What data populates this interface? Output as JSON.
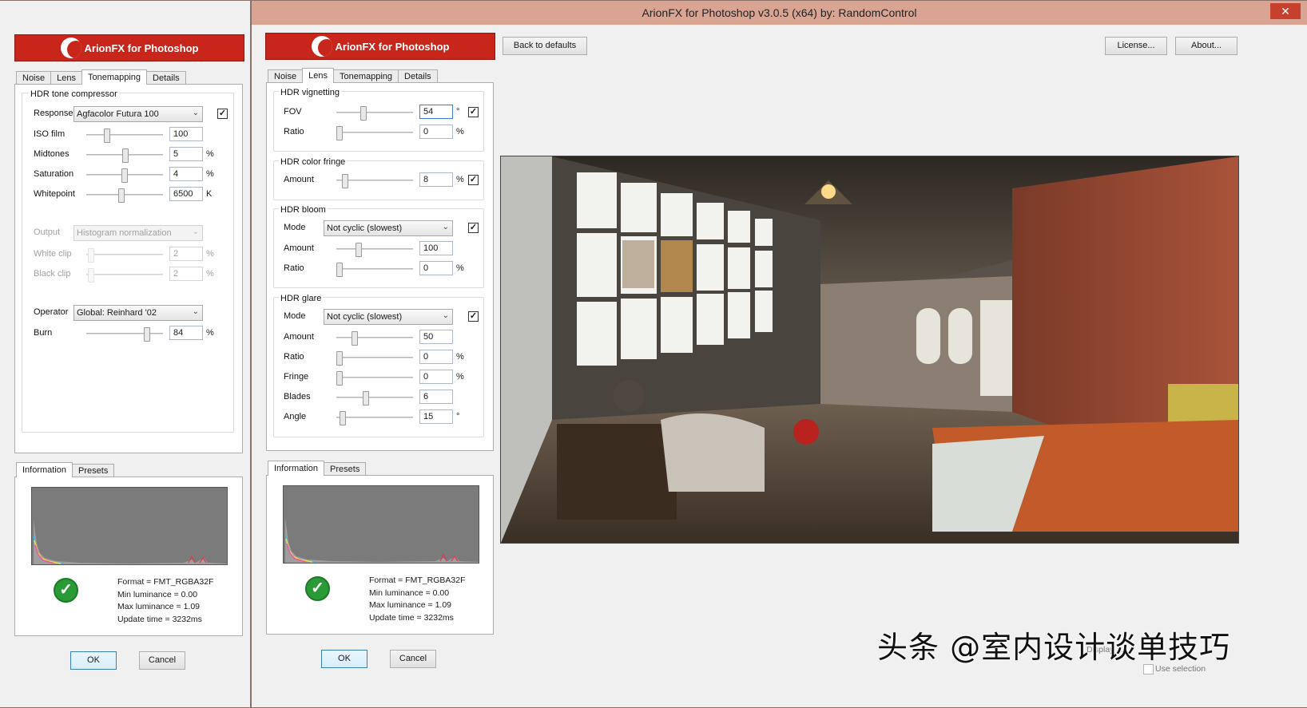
{
  "window_title": "ArionFX for Photoshop v3.0.5 (x64)   by:  RandomControl",
  "close_glyph": "✕",
  "logo_text": "ArionFX for Photoshop",
  "left_panel": {
    "tabs": [
      "Noise",
      "Lens",
      "Tonemapping",
      "Details"
    ],
    "active_tab": "Tonemapping",
    "group_title": "HDR tone compressor",
    "response": {
      "label": "Response",
      "value": "Agfacolor Futura 100",
      "checked": true
    },
    "iso": {
      "label": "ISO film",
      "value": "100"
    },
    "midtones": {
      "label": "Midtones",
      "value": "5",
      "unit": "%"
    },
    "saturation": {
      "label": "Saturation",
      "value": "4",
      "unit": "%"
    },
    "whitepoint": {
      "label": "Whitepoint",
      "value": "6500",
      "unit": "K"
    },
    "output": {
      "label": "Output",
      "value": "Histogram normalization"
    },
    "white_clip": {
      "label": "White clip",
      "value": "2",
      "unit": "%"
    },
    "black_clip": {
      "label": "Black clip",
      "value": "2",
      "unit": "%"
    },
    "operator": {
      "label": "Operator",
      "value": "Global: Reinhard '02"
    },
    "burn": {
      "label": "Burn",
      "value": "84",
      "unit": "%"
    },
    "info_tabs": [
      "Information",
      "Presets"
    ],
    "info": {
      "format": "Format = FMT_RGBA32F",
      "min": "Min luminance = 0.00",
      "max": "Max luminance = 1.09",
      "time": "Update time = 3232ms"
    },
    "ok": "OK",
    "cancel": "Cancel"
  },
  "main_panel": {
    "tabs": [
      "Noise",
      "Lens",
      "Tonemapping",
      "Details"
    ],
    "active_tab": "Lens",
    "back_to_defaults": "Back to defaults",
    "license": "License...",
    "about": "About...",
    "vignetting": {
      "title": "HDR vignetting",
      "fov": {
        "label": "FOV",
        "value": "54",
        "unit": "°",
        "checked": true
      },
      "ratio": {
        "label": "Ratio",
        "value": "0",
        "unit": "%"
      }
    },
    "fringe": {
      "title": "HDR color fringe",
      "amount": {
        "label": "Amount",
        "value": "8",
        "unit": "%",
        "checked": true
      }
    },
    "bloom": {
      "title": "HDR bloom",
      "mode": {
        "label": "Mode",
        "value": "Not cyclic (slowest)",
        "checked": true
      },
      "amount": {
        "label": "Amount",
        "value": "100"
      },
      "ratio": {
        "label": "Ratio",
        "value": "0",
        "unit": "%"
      }
    },
    "glare": {
      "title": "HDR glare",
      "mode": {
        "label": "Mode",
        "value": "Not cyclic (slowest)",
        "checked": true
      },
      "amount": {
        "label": "Amount",
        "value": "50"
      },
      "ratio": {
        "label": "Ratio",
        "value": "0",
        "unit": "%"
      },
      "fringe": {
        "label": "Fringe",
        "value": "0",
        "unit": "%"
      },
      "blades": {
        "label": "Blades",
        "value": "6"
      },
      "angle": {
        "label": "Angle",
        "value": "15",
        "unit": "°"
      }
    },
    "info_tabs": [
      "Information",
      "Presets"
    ],
    "info": {
      "format": "Format = FMT_RGBA32F",
      "min": "Min luminance = 0.00",
      "max": "Max luminance = 1.09",
      "time": "Update time = 3232ms"
    },
    "ok": "OK",
    "cancel": "Cancel",
    "display_fragment": "Display ...",
    "use_selection": "Use selection"
  },
  "watermark": "头条 @室内设计谈单技巧",
  "icons": {
    "check": "✓",
    "chevron": "⌄",
    "status_ok": "✓"
  },
  "colors": {
    "titlebar": "#d9a592",
    "logo": "#c8251b",
    "close": "#c7402e",
    "status_ok": "#2a9a36"
  }
}
